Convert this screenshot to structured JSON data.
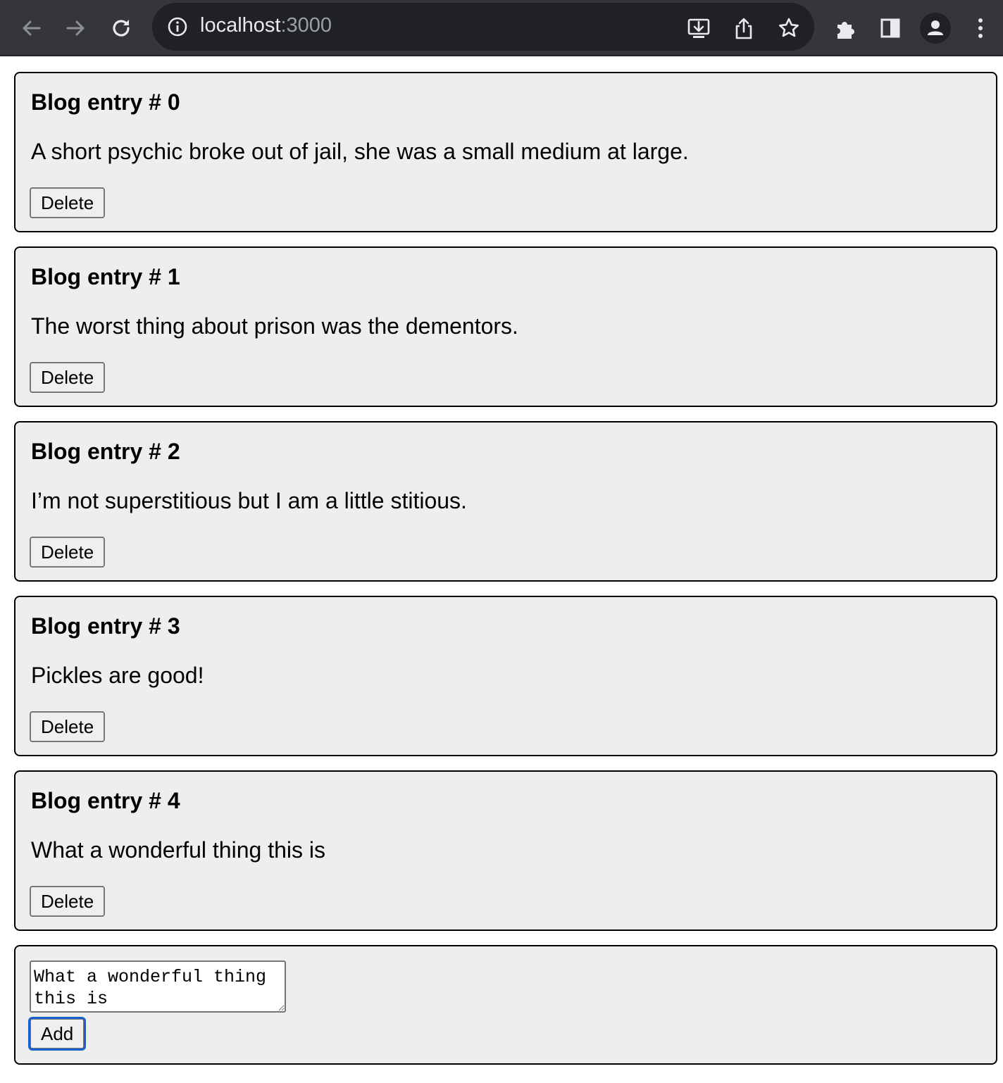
{
  "browser": {
    "url_host": "localhost",
    "url_port": ":3000",
    "icons": [
      "back-arrow-icon",
      "forward-arrow-icon",
      "reload-icon",
      "info-icon",
      "install-icon",
      "share-icon",
      "bookmark-star-icon",
      "extensions-icon",
      "side-panel-icon",
      "profile-icon",
      "menu-kebab-icon"
    ]
  },
  "entries": [
    {
      "title": "Blog entry # 0",
      "text": "A short psychic broke out of jail, she was a small medium at large.",
      "delete_label": "Delete"
    },
    {
      "title": "Blog entry # 1",
      "text": "The worst thing about prison was the dementors.",
      "delete_label": "Delete"
    },
    {
      "title": "Blog entry # 2",
      "text": "I’m not superstitious but I am a little stitious.",
      "delete_label": "Delete"
    },
    {
      "title": "Blog entry # 3",
      "text": "Pickles are good!",
      "delete_label": "Delete"
    },
    {
      "title": "Blog entry # 4",
      "text": "What a wonderful thing this is",
      "delete_label": "Delete"
    }
  ],
  "form": {
    "textarea_value": "What a wonderful thing this is",
    "add_label": "Add"
  },
  "colors": {
    "toolbar_bg": "#35363a",
    "omnibox_bg": "#202124",
    "card_bg": "#eeeeee",
    "focus_ring": "#1a5fd0"
  }
}
